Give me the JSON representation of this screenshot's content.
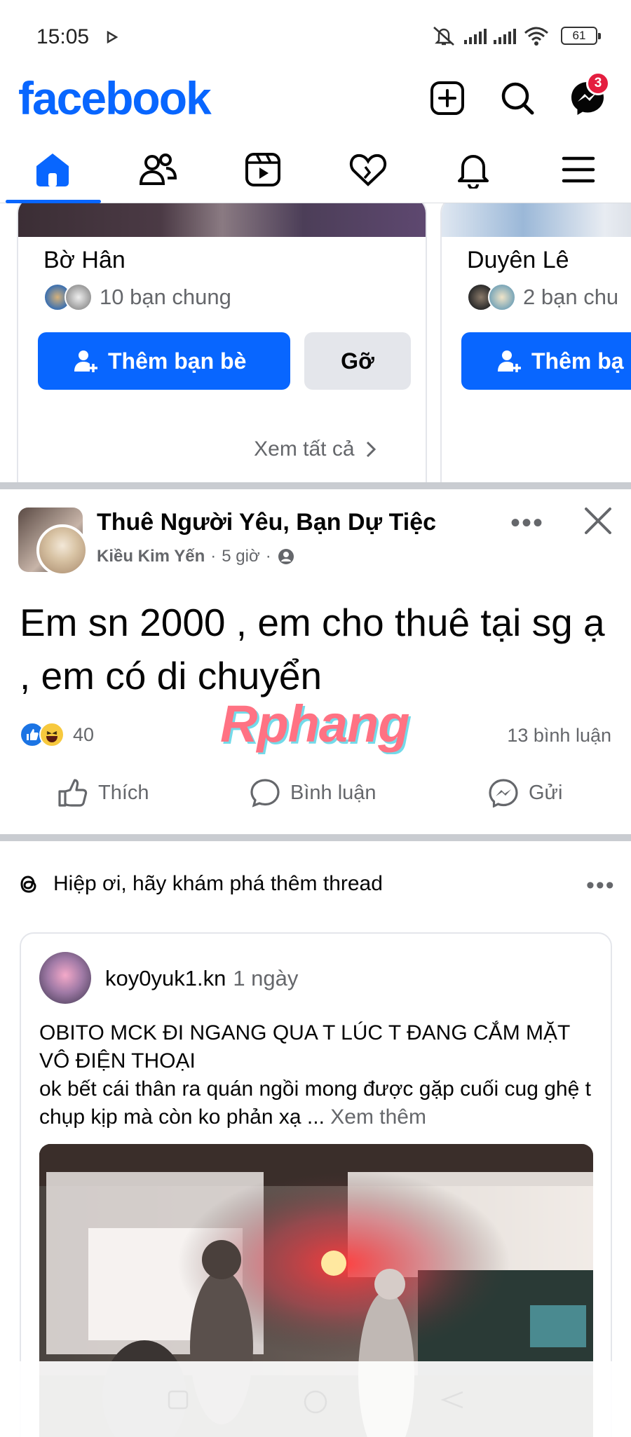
{
  "status_bar": {
    "time": "15:05",
    "battery": "61"
  },
  "header": {
    "logo": "facebook",
    "messenger_badge": "3",
    "brand_color": "#0866ff"
  },
  "nav_tabs": [
    {
      "name": "home",
      "active": true
    },
    {
      "name": "friends",
      "active": false
    },
    {
      "name": "video",
      "active": false
    },
    {
      "name": "dating",
      "active": false
    },
    {
      "name": "notifications",
      "active": false
    },
    {
      "name": "menu",
      "active": false
    }
  ],
  "people_you_may_know": {
    "cards": [
      {
        "name": "Bờ Hân",
        "mutual": "10 bạn chung",
        "add_label": "Thêm bạn bè",
        "remove_label": "Gỡ"
      },
      {
        "name": "Duyên Lê",
        "mutual": "2 bạn chu",
        "add_label": "Thêm bạ"
      }
    ],
    "see_all": "Xem tất cả"
  },
  "post": {
    "group": "Thuê Người Yêu, Bạn Dự Tiệc",
    "author": "Kiều Kim Yến",
    "time": "5 giờ",
    "text": "Em sn 2000 , em cho thuê tại sg ạ , em có di chuyển",
    "watermark": "Rphang",
    "reaction_count": "40",
    "comments": "13 bình luận",
    "actions": {
      "like": "Thích",
      "comment": "Bình luận",
      "send": "Gửi"
    }
  },
  "threads_section": {
    "title": "Hiệp ơi, hãy khám phá thêm thread",
    "card": {
      "username": "koy0yuk1.kn",
      "time": "1 ngày",
      "line1": "OBITO MCK ĐI NGANG QUA T LÚC T ĐANG CẮM MẶT VÔ ĐIỆN THOẠI",
      "line2": "ok bết cái thân ra quán ngồi mong được gặp cuối cug ghệ t chụp kịp mà còn ko phản xạ ...",
      "see_more": "Xem thêm"
    }
  }
}
